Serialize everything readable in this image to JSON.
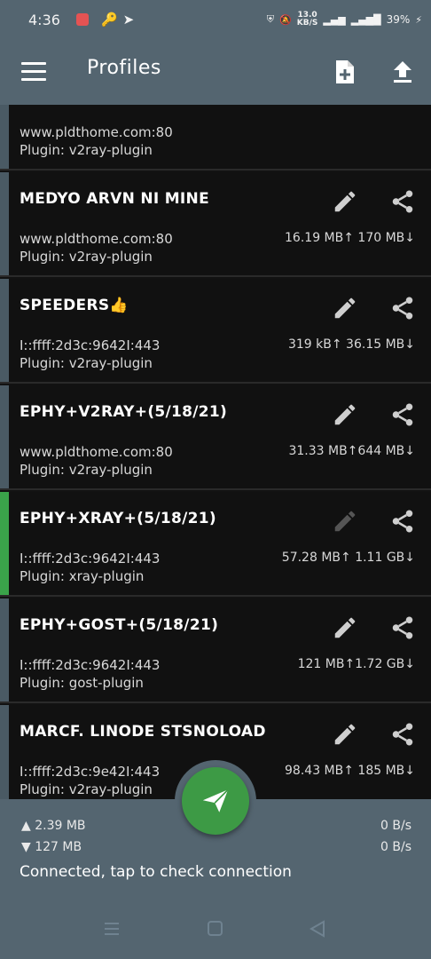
{
  "status_bar": {
    "time": "4:36",
    "net_speed_value": "13.0",
    "net_speed_unit": "KB/S",
    "battery": "39%"
  },
  "toolbar": {
    "title": "Profiles"
  },
  "profiles": [
    {
      "name": "",
      "server": "www.pldthome.com:80",
      "plugin": "Plugin: v2ray-plugin",
      "traffic": ""
    },
    {
      "name": "MEDYO ARVN NI MINE",
      "server": "www.pldthome.com:80",
      "plugin": "Plugin: v2ray-plugin",
      "traffic": "16.19 MB↑ 170 MB↓"
    },
    {
      "name": "SPEEDERS",
      "emoji": "👍",
      "server": "I::ffff:2d3c:9642I:443",
      "plugin": "Plugin: v2ray-plugin",
      "traffic": "319 kB↑ 36.15 MB↓"
    },
    {
      "name": "EPHY+V2RAY+(5/18/21)",
      "server": "www.pldthome.com:80",
      "plugin": "Plugin: v2ray-plugin",
      "traffic": "31.33 MB↑644 MB↓"
    },
    {
      "name": "EPHY+XRAY+(5/18/21)",
      "server": "I::ffff:2d3c:9642I:443",
      "plugin": "Plugin: xray-plugin",
      "traffic": "57.28 MB↑  1.11 GB↓"
    },
    {
      "name": "EPHY+GOST+(5/18/21)",
      "server": "I::ffff:2d3c:9642I:443",
      "plugin": "Plugin: gost-plugin",
      "traffic": "121 MB↑1.72 GB↓"
    },
    {
      "name": "MARCF. LINODE STSNOLOAD",
      "server": "I::ffff:2d3c:9e42I:443",
      "plugin": "Plugin: v2ray-plugin",
      "traffic": "98.43 MB↑  185 MB↓"
    }
  ],
  "stats": {
    "upload_total": "▲ 2.39 MB",
    "download_total": "▼ 127 MB",
    "upload_speed": "0 B/s",
    "download_speed": "0 B/s",
    "connection_status": "Connected, tap to check connection"
  },
  "colors": {
    "toolbar": "#546570",
    "card_bg": "#111111",
    "active_indicator": "#3aa34a",
    "fab": "#3d9a45"
  }
}
